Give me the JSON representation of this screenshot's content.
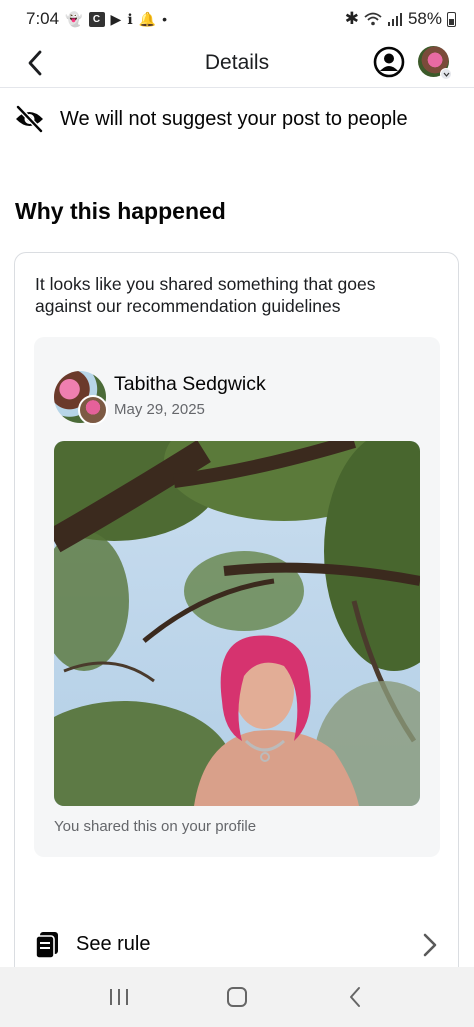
{
  "status_bar": {
    "time": "7:04",
    "battery": "58%",
    "box_icon_letter": "C"
  },
  "header": {
    "title": "Details"
  },
  "banner": {
    "text": "We will not suggest your post to people",
    "icon": "eye-slash-icon"
  },
  "section": {
    "title": "Why this happened",
    "description": "It looks like you shared something that goes against our recommendation guidelines"
  },
  "post": {
    "author": "Tabitha Sedgwick",
    "date": "May 29, 2025",
    "caption": "You shared this on your profile"
  },
  "see_rule": {
    "label": "See rule",
    "icon": "rule-book-icon"
  },
  "colors": {
    "text_primary": "#050505",
    "text_secondary": "#65676b",
    "post_bg": "#f5f6f7",
    "border": "#dadde1",
    "nav_bg": "#f2f2f2"
  }
}
